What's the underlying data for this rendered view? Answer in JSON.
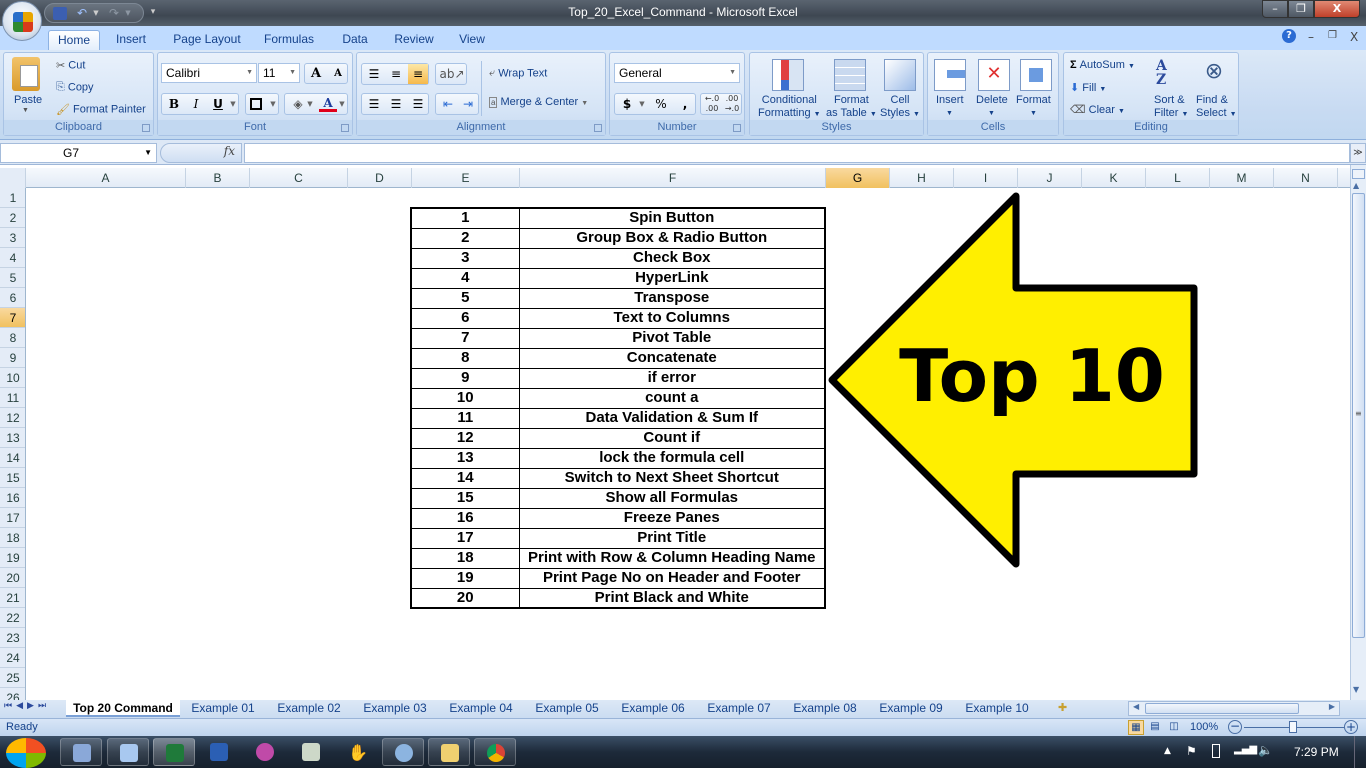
{
  "window": {
    "title": "Top_20_Excel_Command - Microsoft Excel",
    "controls": {
      "minimize": "–",
      "restore": "❐",
      "close": "X"
    }
  },
  "quick_access": {
    "save": "save-icon",
    "undo": "undo-icon",
    "redo": "redo-icon",
    "customize": "customize-icon"
  },
  "ribbon_tabs": [
    "Home",
    "Insert",
    "Page Layout",
    "Formulas",
    "Data",
    "Review",
    "View"
  ],
  "active_tab": "Home",
  "ribbon": {
    "clipboard": {
      "label": "Clipboard",
      "paste": "Paste",
      "cut": "Cut",
      "copy": "Copy",
      "format_painter": "Format Painter"
    },
    "font": {
      "label": "Font",
      "font_name": "Calibri",
      "font_size": "11",
      "bold": "B",
      "italic": "I",
      "underline": "U",
      "grow": "A",
      "shrink": "A",
      "font_color": "A",
      "font_color_hex": "#e0001a"
    },
    "alignment": {
      "label": "Alignment",
      "wrap_text": "Wrap Text",
      "merge_center": "Merge & Center"
    },
    "number": {
      "label": "Number",
      "format": "General",
      "currency": "$",
      "percent": "%",
      "comma": ",",
      "inc_decimal": ".0→.00",
      "dec_decimal": ".00→.0"
    },
    "styles": {
      "label": "Styles",
      "conditional_formatting": [
        "Conditional",
        "Formatting"
      ],
      "format_as_table": [
        "Format",
        "as Table"
      ],
      "cell_styles": [
        "Cell",
        "Styles"
      ]
    },
    "cells": {
      "label": "Cells",
      "insert": "Insert",
      "delete": "Delete",
      "format": "Format"
    },
    "editing": {
      "label": "Editing",
      "autosum": "AutoSum",
      "fill": "Fill",
      "clear": "Clear",
      "sort_filter": [
        "Sort &",
        "Filter"
      ],
      "find_select": [
        "Find &",
        "Select"
      ]
    }
  },
  "formula_bar": {
    "name_box": "G7",
    "fx": "fx",
    "value": ""
  },
  "columns": [
    "A",
    "B",
    "C",
    "D",
    "E",
    "F",
    "G",
    "H",
    "I",
    "J",
    "K",
    "L",
    "M",
    "N"
  ],
  "selected_column": "G",
  "rows": [
    "1",
    "2",
    "3",
    "4",
    "5",
    "6",
    "7",
    "8",
    "9",
    "10",
    "11",
    "12",
    "13",
    "14",
    "15",
    "16",
    "17",
    "18",
    "19",
    "20",
    "21",
    "22",
    "23",
    "24",
    "25",
    "26"
  ],
  "selected_row": "7",
  "commands": [
    {
      "num": "1",
      "name": "Spin Button"
    },
    {
      "num": "2",
      "name": "Group Box & Radio Button"
    },
    {
      "num": "3",
      "name": "Check Box"
    },
    {
      "num": "4",
      "name": "HyperLink"
    },
    {
      "num": "5",
      "name": "Transpose"
    },
    {
      "num": "6",
      "name": "Text to Columns"
    },
    {
      "num": "7",
      "name": "Pivot Table"
    },
    {
      "num": "8",
      "name": "Concatenate"
    },
    {
      "num": "9",
      "name": "if error"
    },
    {
      "num": "10",
      "name": "count a"
    },
    {
      "num": "11",
      "name": "Data Validation & Sum If"
    },
    {
      "num": "12",
      "name": "Count if"
    },
    {
      "num": "13",
      "name": "lock the formula cell"
    },
    {
      "num": "14",
      "name": "Switch to Next Sheet Shortcut"
    },
    {
      "num": "15",
      "name": "Show all Formulas"
    },
    {
      "num": "16",
      "name": "Freeze Panes"
    },
    {
      "num": "17",
      "name": "Print Title"
    },
    {
      "num": "18",
      "name": "Print with Row & Column Heading Name"
    },
    {
      "num": "19",
      "name": "Print Page No on Header and Footer"
    },
    {
      "num": "20",
      "name": "Print Black and White"
    }
  ],
  "arrow_shape": {
    "text": "Top 10",
    "fill": "#ffef00",
    "stroke": "#000000"
  },
  "sheet_tabs": [
    "Top 20 Command",
    "Example 01",
    "Example 02",
    "Example 03",
    "Example 04",
    "Example 05",
    "Example 06",
    "Example 07",
    "Example 08",
    "Example 09",
    "Example 10"
  ],
  "active_sheet": "Top 20 Command",
  "status": {
    "mode": "Ready",
    "zoom": "100%"
  },
  "taskbar": {
    "apps": [
      "paint",
      "notepad",
      "excel",
      "word",
      "app-purple",
      "app-reader",
      "app-hand",
      "app-audio",
      "explorer",
      "chrome"
    ],
    "clock": "7:29 PM"
  }
}
